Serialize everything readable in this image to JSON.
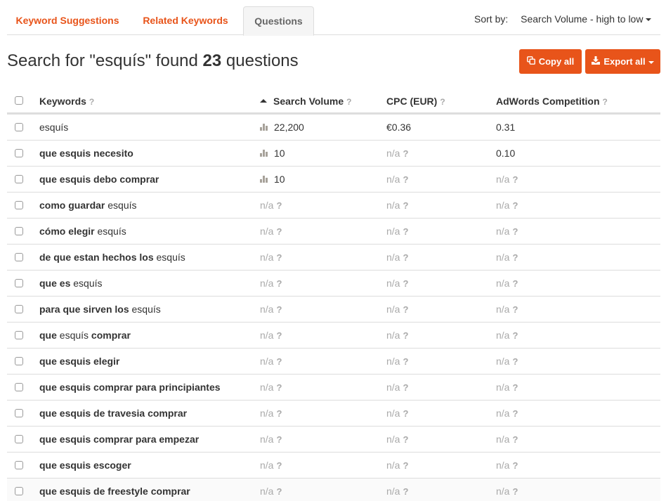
{
  "tabs": [
    {
      "label": "Keyword Suggestions",
      "active": false
    },
    {
      "label": "Related Keywords",
      "active": false
    },
    {
      "label": "Questions",
      "active": true
    }
  ],
  "sort": {
    "label": "Sort by:",
    "value": "Search Volume - high to low"
  },
  "title": {
    "prefix": "Search for \"esquís\" found ",
    "count": "23",
    "suffix": " questions"
  },
  "buttons": {
    "copy_all": "Copy all",
    "export_all": "Export all"
  },
  "colors": {
    "accent": "#e8541a",
    "na_gray": "#aaaaaa",
    "text": "#333333"
  },
  "table": {
    "columns": [
      {
        "label": "Keywords",
        "help": "?"
      },
      {
        "label": "Search Volume",
        "help": "?",
        "sorted": "asc"
      },
      {
        "label": "CPC (EUR)",
        "help": "?"
      },
      {
        "label": "AdWords Competition",
        "help": "?"
      }
    ],
    "na_label": "n/a",
    "na_help": "?",
    "rows": [
      {
        "keyword": [
          {
            "text": "esquís",
            "bold": false
          }
        ],
        "search_volume": "22,200",
        "cpc": "€0.36",
        "competition": "0.31"
      },
      {
        "keyword": [
          {
            "text": "que esquis necesito",
            "bold": true
          }
        ],
        "search_volume": "10",
        "cpc": "n/a",
        "competition": "0.10"
      },
      {
        "keyword": [
          {
            "text": "que esquis debo comprar",
            "bold": true
          }
        ],
        "search_volume": "10",
        "cpc": "n/a",
        "competition": "n/a"
      },
      {
        "keyword": [
          {
            "text": "como guardar",
            "bold": true
          },
          {
            "text": " esquís",
            "bold": false
          }
        ],
        "search_volume": "n/a",
        "cpc": "n/a",
        "competition": "n/a"
      },
      {
        "keyword": [
          {
            "text": "cómo elegir",
            "bold": true
          },
          {
            "text": " esquís",
            "bold": false
          }
        ],
        "search_volume": "n/a",
        "cpc": "n/a",
        "competition": "n/a"
      },
      {
        "keyword": [
          {
            "text": "de que estan hechos los",
            "bold": true
          },
          {
            "text": " esquís",
            "bold": false
          }
        ],
        "search_volume": "n/a",
        "cpc": "n/a",
        "competition": "n/a"
      },
      {
        "keyword": [
          {
            "text": "que es",
            "bold": true
          },
          {
            "text": " esquís",
            "bold": false
          }
        ],
        "search_volume": "n/a",
        "cpc": "n/a",
        "competition": "n/a"
      },
      {
        "keyword": [
          {
            "text": "para que sirven los",
            "bold": true
          },
          {
            "text": " esquís",
            "bold": false
          }
        ],
        "search_volume": "n/a",
        "cpc": "n/a",
        "competition": "n/a"
      },
      {
        "keyword": [
          {
            "text": "que",
            "bold": true
          },
          {
            "text": " esquís ",
            "bold": false
          },
          {
            "text": "comprar",
            "bold": true
          }
        ],
        "search_volume": "n/a",
        "cpc": "n/a",
        "competition": "n/a"
      },
      {
        "keyword": [
          {
            "text": "que esquis elegir",
            "bold": true
          }
        ],
        "search_volume": "n/a",
        "cpc": "n/a",
        "competition": "n/a"
      },
      {
        "keyword": [
          {
            "text": "que esquis comprar para principiantes",
            "bold": true
          }
        ],
        "search_volume": "n/a",
        "cpc": "n/a",
        "competition": "n/a"
      },
      {
        "keyword": [
          {
            "text": "que esquis de travesia comprar",
            "bold": true
          }
        ],
        "search_volume": "n/a",
        "cpc": "n/a",
        "competition": "n/a"
      },
      {
        "keyword": [
          {
            "text": "que esquis comprar para empezar",
            "bold": true
          }
        ],
        "search_volume": "n/a",
        "cpc": "n/a",
        "competition": "n/a"
      },
      {
        "keyword": [
          {
            "text": "que esquis escoger",
            "bold": true
          }
        ],
        "search_volume": "n/a",
        "cpc": "n/a",
        "competition": "n/a"
      },
      {
        "keyword": [
          {
            "text": "que esquis de freestyle comprar",
            "bold": true
          }
        ],
        "search_volume": "n/a",
        "cpc": "n/a",
        "competition": "n/a"
      }
    ]
  }
}
